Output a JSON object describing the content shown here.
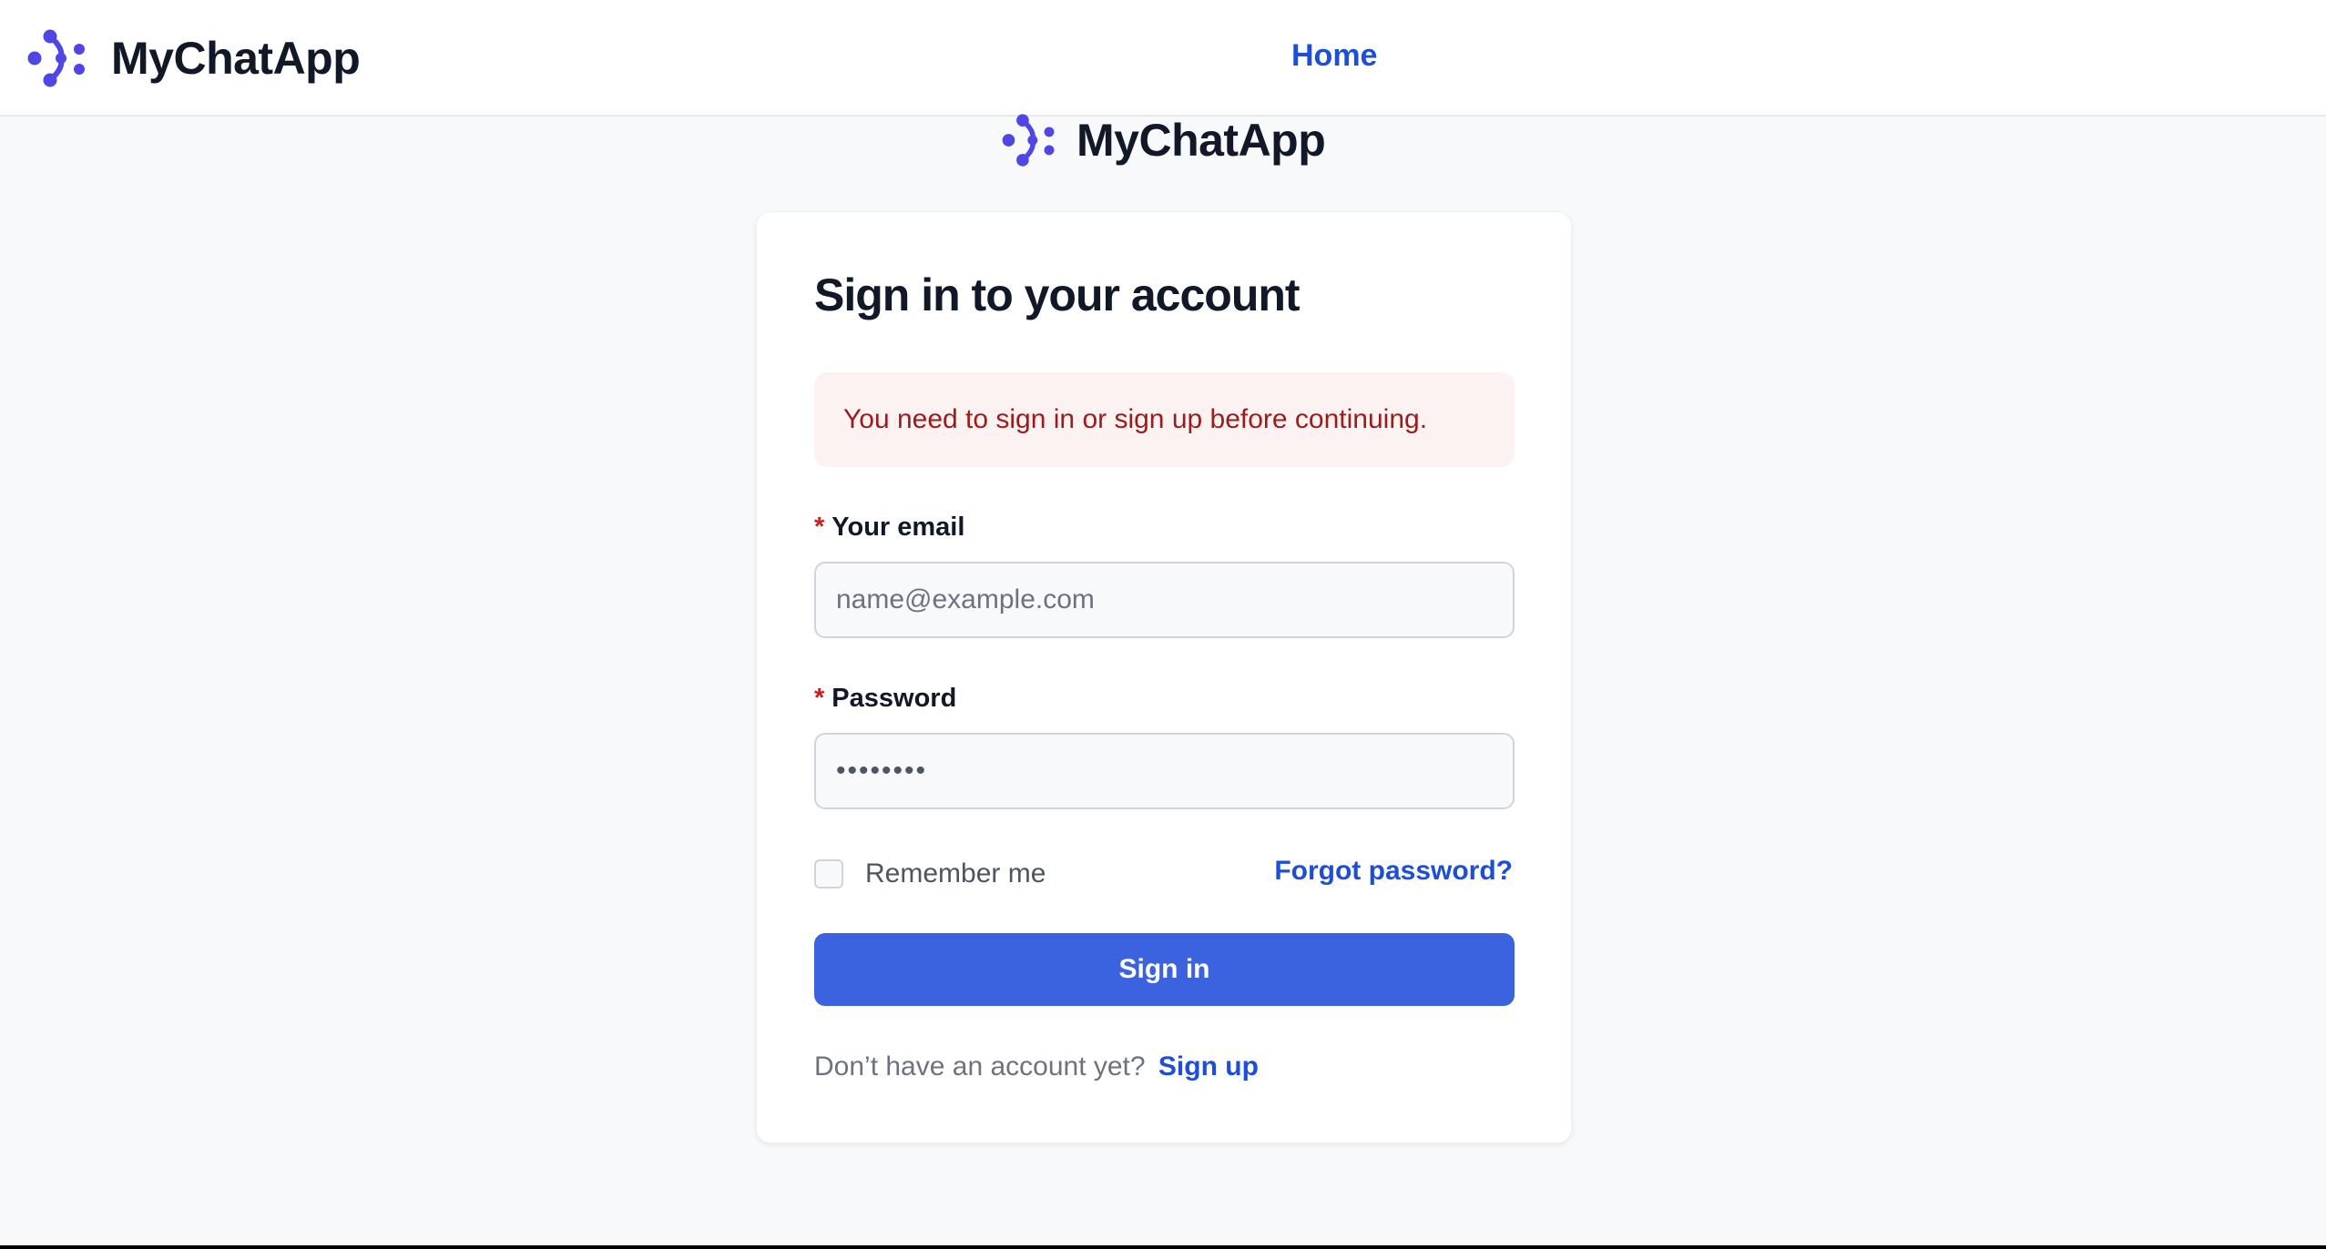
{
  "header": {
    "brand_name": "MyChatApp",
    "nav_home": "Home"
  },
  "center_brand": {
    "brand_name": "MyChatApp"
  },
  "form": {
    "title": "Sign in to your account",
    "alert_message": "You need to sign in or sign up before continuing.",
    "email_label": "Your email",
    "email_placeholder": "name@example.com",
    "email_value": "",
    "password_label": "Password",
    "password_value_masked": "••••••••",
    "required_marker": "*",
    "remember_label": "Remember me",
    "remember_checked": false,
    "forgot_label": "Forgot password?",
    "submit_label": "Sign in",
    "signup_prompt": "Don’t have an account yet?",
    "signup_label": "Sign up"
  },
  "icons": {
    "logo": "mychatapp-logo-icon"
  },
  "colors": {
    "brand_purple": "#4f46e5",
    "link_blue": "#1d4ed8",
    "button_blue": "#3b63e0",
    "alert_bg": "#fdf2f2",
    "alert_text": "#9b1c1c",
    "required_red": "#c81e1e"
  }
}
